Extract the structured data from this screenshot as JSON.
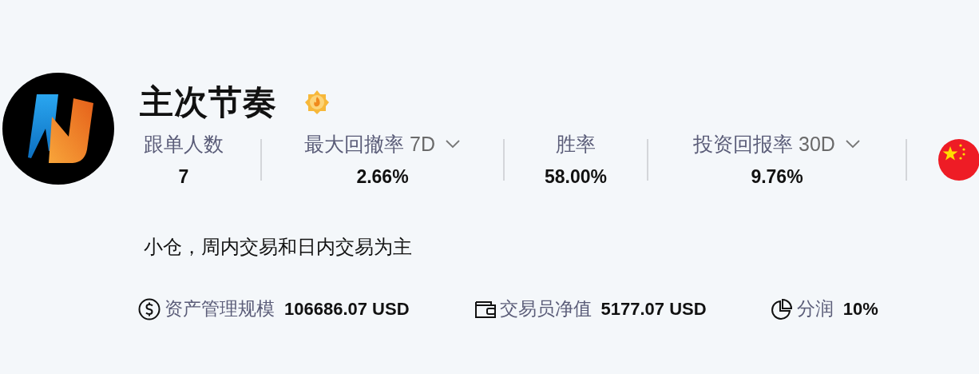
{
  "profile": {
    "name": "主次节奏"
  },
  "stats": [
    {
      "label": "跟单人数",
      "value": "7",
      "dropdown": false
    },
    {
      "label": "最大回撤率",
      "period": "7D",
      "value": "2.66%",
      "dropdown": true
    },
    {
      "label": "胜率",
      "value": "58.00%",
      "dropdown": false
    },
    {
      "label": "投资回报率",
      "period": "30D",
      "value": "9.76%",
      "dropdown": true
    }
  ],
  "description": "小仓，周内交易和日内交易为主",
  "details": [
    {
      "kind": "dollar",
      "label": "资产管理规模",
      "value": "106686.07 USD"
    },
    {
      "kind": "wallet",
      "label": "交易员净值",
      "value": "5177.07 USD"
    },
    {
      "kind": "pie",
      "label": "分润",
      "value": "10%"
    }
  ]
}
